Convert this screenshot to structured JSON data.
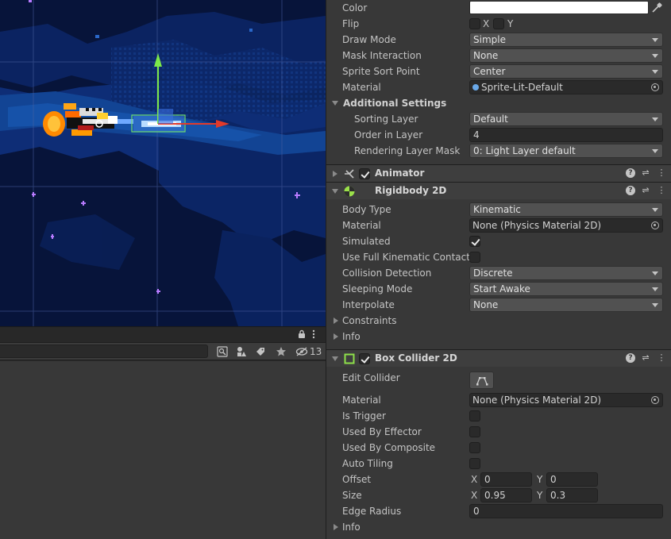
{
  "scene": {
    "gizmo_colors": {
      "y_axis": "#7ce84a",
      "x_axis": "#e23a2a",
      "collider": "#6fdc6f"
    },
    "background_color": "#07143a"
  },
  "project": {
    "hidden_count": "13"
  },
  "inspector": {
    "sprite_renderer": {
      "color_label": "Color",
      "color_value": "#ffffff",
      "flip_label": "Flip",
      "flip_x": "X",
      "flip_y": "Y",
      "draw_mode_label": "Draw Mode",
      "draw_mode_value": "Simple",
      "mask_interaction_label": "Mask Interaction",
      "mask_interaction_value": "None",
      "sprite_sort_point_label": "Sprite Sort Point",
      "sprite_sort_point_value": "Center",
      "material_label": "Material",
      "material_value": "Sprite-Lit-Default",
      "additional_settings_label": "Additional Settings",
      "sorting_layer_label": "Sorting Layer",
      "sorting_layer_value": "Default",
      "order_in_layer_label": "Order in Layer",
      "order_in_layer_value": "4",
      "rendering_layer_mask_label": "Rendering Layer Mask",
      "rendering_layer_mask_value": "0: Light Layer default"
    },
    "animator": {
      "title": "Animator"
    },
    "rigidbody2d": {
      "title": "Rigidbody 2D",
      "body_type_label": "Body Type",
      "body_type_value": "Kinematic",
      "material_label": "Material",
      "material_value": "None (Physics Material 2D)",
      "simulated_label": "Simulated",
      "simulated": true,
      "full_kinematic_label": "Use Full Kinematic Contacts",
      "full_kinematic": false,
      "collision_detection_label": "Collision Detection",
      "collision_detection_value": "Discrete",
      "sleeping_mode_label": "Sleeping Mode",
      "sleeping_mode_value": "Start Awake",
      "interpolate_label": "Interpolate",
      "interpolate_value": "None",
      "constraints_label": "Constraints",
      "info_label": "Info"
    },
    "box_collider": {
      "title": "Box Collider 2D",
      "edit_collider_label": "Edit Collider",
      "material_label": "Material",
      "material_value": "None (Physics Material 2D)",
      "is_trigger_label": "Is Trigger",
      "used_by_effector_label": "Used By Effector",
      "used_by_composite_label": "Used By Composite",
      "auto_tiling_label": "Auto Tiling",
      "offset_label": "Offset",
      "offset_x": "0",
      "offset_y": "0",
      "size_label": "Size",
      "size_x": "0.95",
      "size_y": "0.3",
      "edge_radius_label": "Edge Radius",
      "edge_radius_value": "0",
      "info_label": "Info",
      "x_label": "X",
      "y_label": "Y"
    }
  }
}
